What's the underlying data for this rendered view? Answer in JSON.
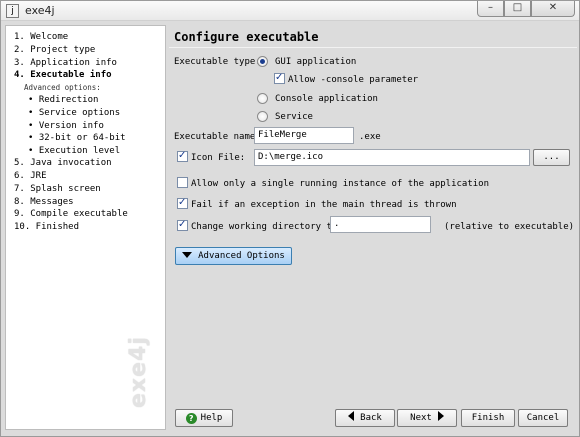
{
  "window": {
    "title": "exe4j",
    "min": "–",
    "max": "□",
    "close": "✕"
  },
  "sidebar": {
    "items": [
      {
        "label": "1. Welcome"
      },
      {
        "label": "2. Project type"
      },
      {
        "label": "3. Application info"
      },
      {
        "label": "4. Executable info"
      },
      {
        "label": "5. Java invocation"
      },
      {
        "label": "6. JRE"
      },
      {
        "label": "7. Splash screen"
      },
      {
        "label": "8. Messages"
      },
      {
        "label": "9. Compile executable"
      },
      {
        "label": "10. Finished"
      }
    ],
    "advanced_label": "Advanced options:",
    "sub_items": [
      {
        "label": "• Redirection"
      },
      {
        "label": "• Service options"
      },
      {
        "label": "• Version info"
      },
      {
        "label": "• 32-bit or 64-bit"
      },
      {
        "label": "• Execution level"
      }
    ],
    "watermark": "exe4j"
  },
  "main": {
    "heading": "Configure executable",
    "exe_type_label": "Executable type:",
    "options": {
      "gui": "GUI application",
      "allow_console": "Allow -console parameter",
      "console": "Console application",
      "service": "Service"
    },
    "exe_name_label": "Executable name:",
    "exe_name_value": "FileMerge",
    "exe_ext": ".exe",
    "icon_label": "Icon File:",
    "icon_value": "D:\\merge.ico",
    "browse_label": "...",
    "single_instance": "Allow only a single running instance of the application",
    "fail_exception": "Fail if an exception in the main thread is thrown",
    "change_dir_label": "Change working directory to:",
    "change_dir_value": ".",
    "change_dir_hint": "(relative to executable)",
    "advanced_button": "Advanced Options"
  },
  "footer": {
    "help": "Help",
    "back": "Back",
    "next": "Next",
    "finish": "Finish",
    "cancel": "Cancel"
  }
}
